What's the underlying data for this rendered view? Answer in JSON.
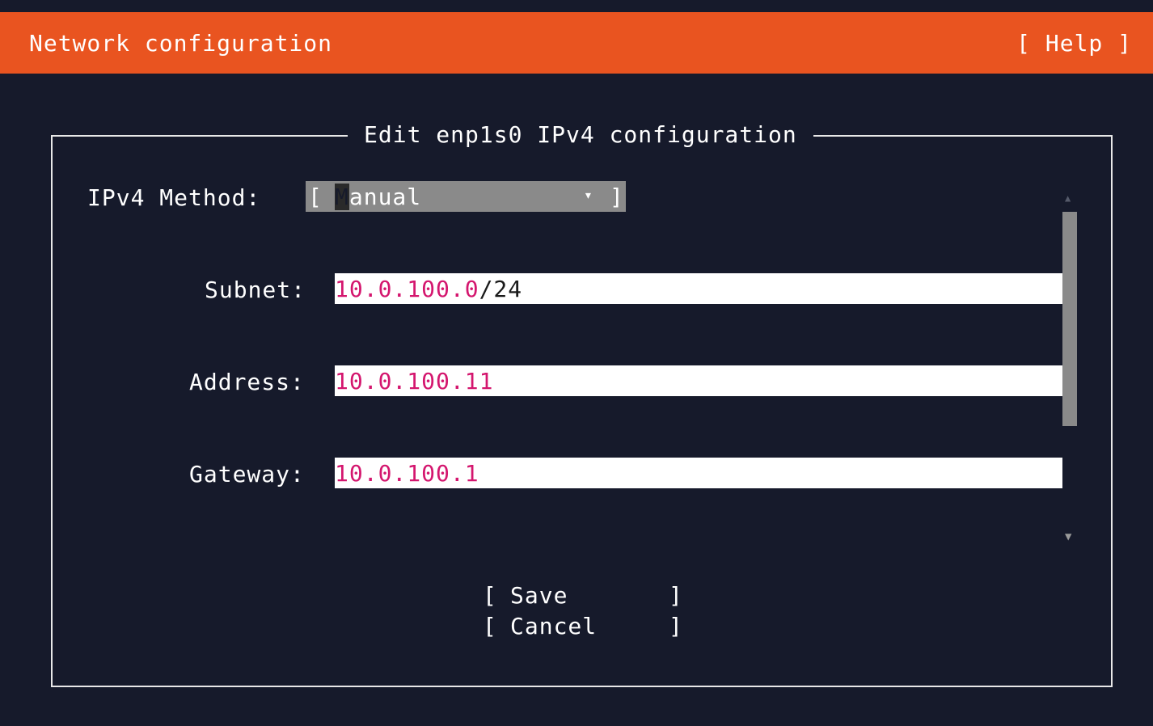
{
  "header": {
    "title": "Network configuration",
    "help": "[ Help ]"
  },
  "dialog": {
    "title": "Edit enp1s0 IPv4 configuration",
    "method": {
      "label": "IPv4 Method:",
      "bracket_left": "[",
      "bracket_right": "]",
      "cursor_char": "M",
      "rest": "anual",
      "arrow": "▾"
    },
    "subnet": {
      "label": "Subnet:",
      "value": "10.0.100.0",
      "suffix": "/24"
    },
    "address": {
      "label": "Address:",
      "value": "10.0.100.11"
    },
    "gateway": {
      "label": "Gateway:",
      "value": "10.0.100.1"
    },
    "scroll": {
      "up": "▲",
      "down": "▼"
    },
    "buttons": {
      "bracket_left": "[",
      "bracket_right": "]",
      "save": "Save",
      "cancel": "Cancel"
    }
  },
  "colors": {
    "header_bg": "#e95420",
    "background": "#161a2b",
    "field_text": "#d4166e",
    "select_bg": "#8a8a8a"
  }
}
